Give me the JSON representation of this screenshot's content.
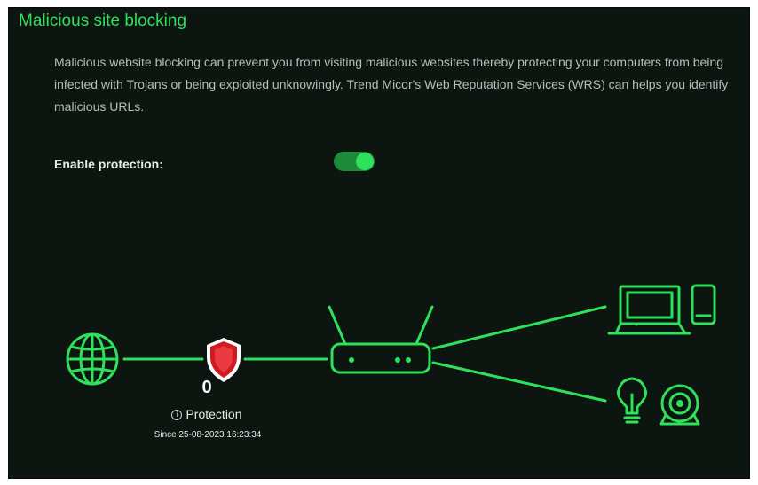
{
  "section": {
    "title": "Malicious site blocking",
    "description": "Malicious website blocking can prevent you from visiting malicious websites thereby protecting your computers from being infected with Trojans or being exploited unknowingly. Trend Micor's Web Reputation Services (WRS) can helps you identify malicious URLs.",
    "enable_label": "Enable protection:",
    "enable_on": true
  },
  "stats": {
    "count": "0",
    "protection_label": "Protection",
    "since": "Since 25-08-2023 16:23:34"
  },
  "diagram": {
    "nodes": [
      "globe-icon",
      "shield-icon",
      "router-icon",
      "laptop-icon",
      "phone-icon",
      "lightbulb-icon",
      "webcam-icon"
    ],
    "line_color": "#2ee05a",
    "shield_color": "#d11a22"
  },
  "colors": {
    "accent": "#2ee05a",
    "toggle_track": "#1e8a3c",
    "panel_bg": "#0c1510"
  }
}
